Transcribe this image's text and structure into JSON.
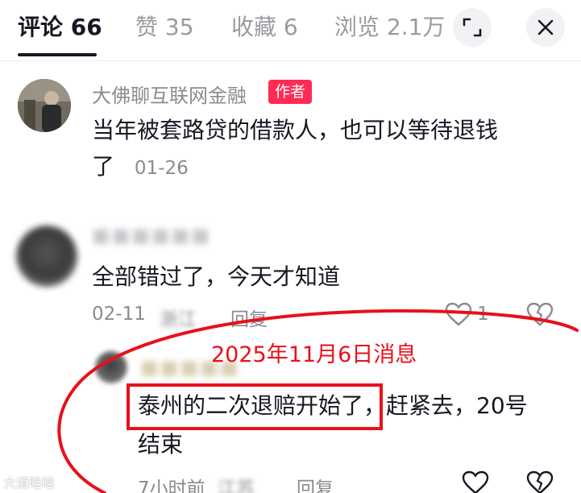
{
  "tabs": {
    "comments": "评论 66",
    "likes": "赞 35",
    "favorites": "收藏 6",
    "views": "浏览 2.1万"
  },
  "header_icons": [
    "expand-icon",
    "close-icon"
  ],
  "comments": [
    {
      "username": "大佛聊互联网金融",
      "badge": "作者",
      "text_line1": "当年被套路贷的借款人，也可以等待退钱",
      "text_line2": "了",
      "date": "01-26"
    },
    {
      "username": "■■■■■■",
      "text": "全部错过了，今天才知道",
      "date": "02-11",
      "location": "浙江",
      "reply_label": "回复",
      "like_count": "1"
    },
    {
      "username": "■■■■■",
      "text_highlighted": "泰州的二次退赔开始了",
      "text_rest": "，赶紧去，20号",
      "text_line2": "结束",
      "date": "7小时前",
      "location": "江苏",
      "reply_label": "回复"
    }
  ],
  "annotation": {
    "news_label": "2025年11月6日消息",
    "color": "#e8101b"
  },
  "watermark": "大道晗晗"
}
